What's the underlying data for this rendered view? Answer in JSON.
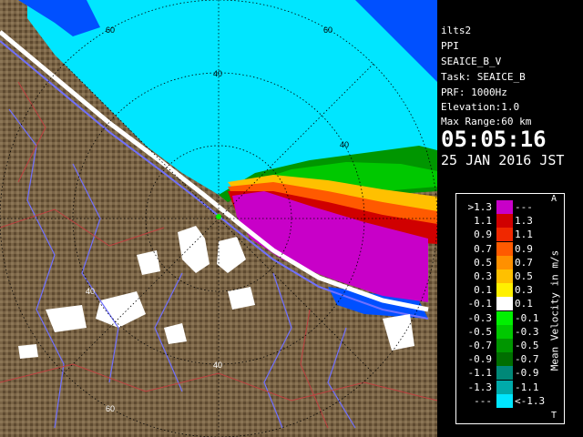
{
  "info": {
    "site": "ilts2",
    "mode": "PPI",
    "product": "SEAICE_B_V",
    "task": "Task: SEAICE_B",
    "prf": "PRF: 1000Hz",
    "elevation": "Elevation:1.0",
    "max_range": "Max Range:60 km",
    "time": "05:05:16",
    "date": "25 JAN 2016 JST"
  },
  "range_labels": {
    "r40_top": "40",
    "r60_top": "60",
    "r40_upright": "40",
    "r60_upleft": "60",
    "r40_left": "40",
    "r40_bottom": "40",
    "r60_bottom": "60"
  },
  "legend": {
    "title": "Mean Velocity in m/s",
    "top_mark": "A",
    "bottom_mark": "T",
    "rows": [
      {
        "lo": ">1.3",
        "hi": "---",
        "color": "#c800c8"
      },
      {
        "lo": "1.1",
        "hi": "1.3",
        "color": "#d00000"
      },
      {
        "lo": "0.9",
        "hi": "1.1",
        "color": "#f02800"
      },
      {
        "lo": "0.7",
        "hi": "0.9",
        "color": "#ff5a00"
      },
      {
        "lo": "0.5",
        "hi": "0.7",
        "color": "#ff9000"
      },
      {
        "lo": "0.3",
        "hi": "0.5",
        "color": "#ffc000"
      },
      {
        "lo": "0.1",
        "hi": "0.3",
        "color": "#fff000"
      },
      {
        "lo": "-0.1",
        "hi": "0.1",
        "color": "#ffffff"
      },
      {
        "lo": "-0.3",
        "hi": "-0.1",
        "color": "#00f000"
      },
      {
        "lo": "-0.5",
        "hi": "-0.3",
        "color": "#00c800"
      },
      {
        "lo": "-0.7",
        "hi": "-0.5",
        "color": "#009600"
      },
      {
        "lo": "-0.9",
        "hi": "-0.7",
        "color": "#006e00"
      },
      {
        "lo": "-1.1",
        "hi": "-0.9",
        "color": "#008878"
      },
      {
        "lo": "-1.3",
        "hi": "-1.1",
        "color": "#00aaaa"
      },
      {
        "lo": "---",
        "hi": "<-1.3",
        "color": "#00e6ff"
      }
    ]
  },
  "colors": {
    "land": "#7a6446",
    "ocean_ice": "#00e6ff",
    "deep": "#0050ff",
    "coast_line": "#ffffff",
    "road": "#7070ff",
    "boundary": "#c04040",
    "grid": "#000000"
  }
}
